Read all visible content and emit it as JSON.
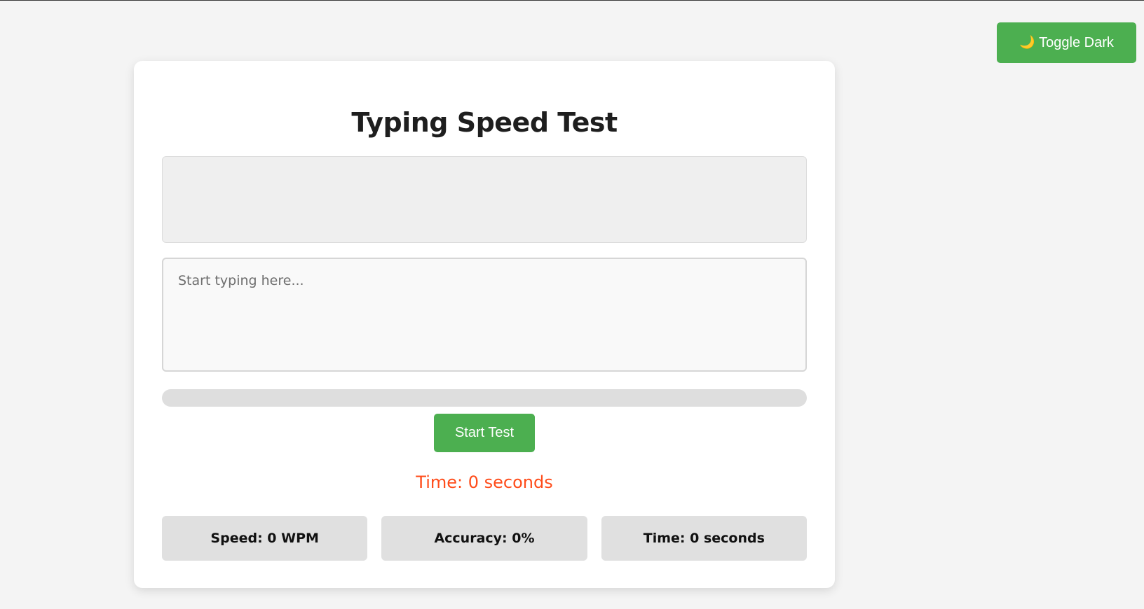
{
  "toggle": {
    "icon": "moon-icon",
    "icon_glyph": "🌙",
    "label": "Toggle Dark"
  },
  "app": {
    "title": "Typing Speed Test",
    "quote_text": "",
    "input_value": "",
    "input_placeholder": "Start typing here...",
    "progress_percent": 0,
    "start_label": "Start Test",
    "timer_text": "Time: 0 seconds"
  },
  "stats": [
    {
      "label": "Speed: 0 WPM"
    },
    {
      "label": "Accuracy: 0%"
    },
    {
      "label": "Time: 0 seconds"
    }
  ],
  "colors": {
    "accent": "#4caf50",
    "timer": "#ff4c1a",
    "background": "#f4f4f4",
    "card": "#ffffff"
  }
}
